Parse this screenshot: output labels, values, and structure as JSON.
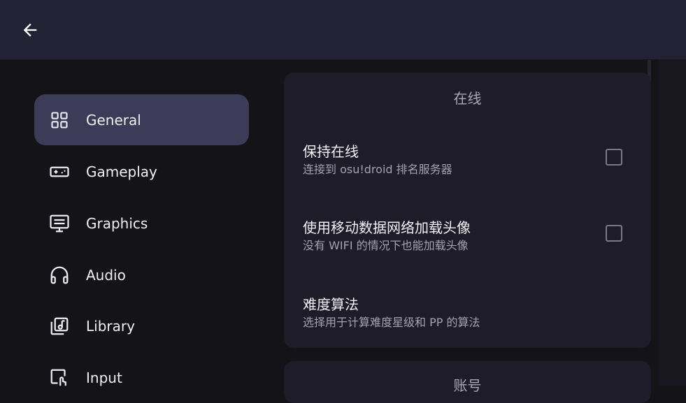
{
  "topbar": {
    "back_icon": "arrow-left-icon"
  },
  "sidebar": {
    "items": [
      {
        "label": "General",
        "icon": "grid-icon",
        "active": true
      },
      {
        "label": "Gameplay",
        "icon": "gamepad-icon",
        "active": false
      },
      {
        "label": "Graphics",
        "icon": "monitor-icon",
        "active": false
      },
      {
        "label": "Audio",
        "icon": "headphones-icon",
        "active": false
      },
      {
        "label": "Library",
        "icon": "music-library-icon",
        "active": false
      },
      {
        "label": "Input",
        "icon": "touch-icon",
        "active": false
      }
    ]
  },
  "sections": [
    {
      "title": "在线",
      "prefs": [
        {
          "title": "保持在线",
          "summary": "连接到 osu!droid 排名服务器",
          "checked": false
        },
        {
          "title": "使用移动数据网络加载头像",
          "summary": "没有 WIFI 的情况下也能加载头像",
          "checked": false
        },
        {
          "title": "难度算法",
          "summary": "选择用于计算难度星级和 PP 的算法"
        }
      ]
    },
    {
      "title": "账号"
    }
  ],
  "colors": {
    "background": "#131318",
    "topbar": "#232235",
    "active_item": "#3c3b58",
    "card": "#1d1c28"
  }
}
